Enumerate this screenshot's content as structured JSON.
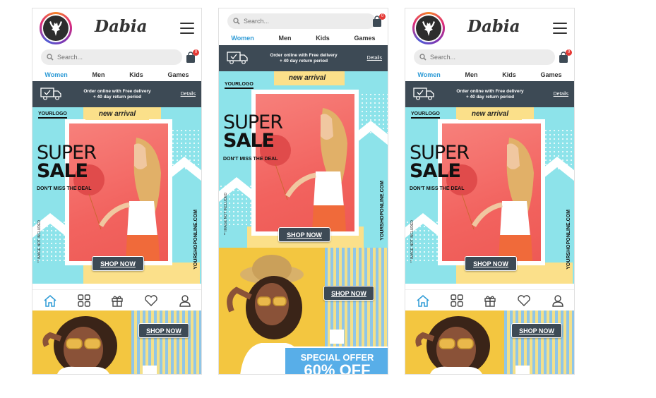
{
  "app": {
    "brand": "Dabia",
    "search_placeholder": "Search...",
    "cart_count": "0",
    "tabs": [
      "Women",
      "Men",
      "Kids",
      "Games"
    ],
    "active_tab": "Women",
    "banner": {
      "line1": "Order online with Free delivery",
      "line2": "+ 40 day return period",
      "details": "Details"
    },
    "hero": {
      "logo_text": "YOURLOGO",
      "new_arrival": "new arrival",
      "super": "SUPER",
      "sale": "SALE",
      "tagline": "DON'T MISS THE DEAL",
      "shop_now": "SHOP NOW",
      "site": "YOURSHOPONLINE.COM",
      "disclaimer": "** IMAGE NOT INCLUDED"
    },
    "promo": {
      "shop_now": "SHOP NOW",
      "special": "SPECIAL OFFER",
      "percent": "60% OFF"
    },
    "bottom_nav": [
      "home-icon",
      "grid-icon",
      "gift-icon",
      "heart-icon",
      "user-icon"
    ],
    "colors": {
      "accent": "#2e9bd6",
      "banner": "#3d4a55",
      "hero_bg": "#8de3ea",
      "badge": "#e53935"
    }
  }
}
